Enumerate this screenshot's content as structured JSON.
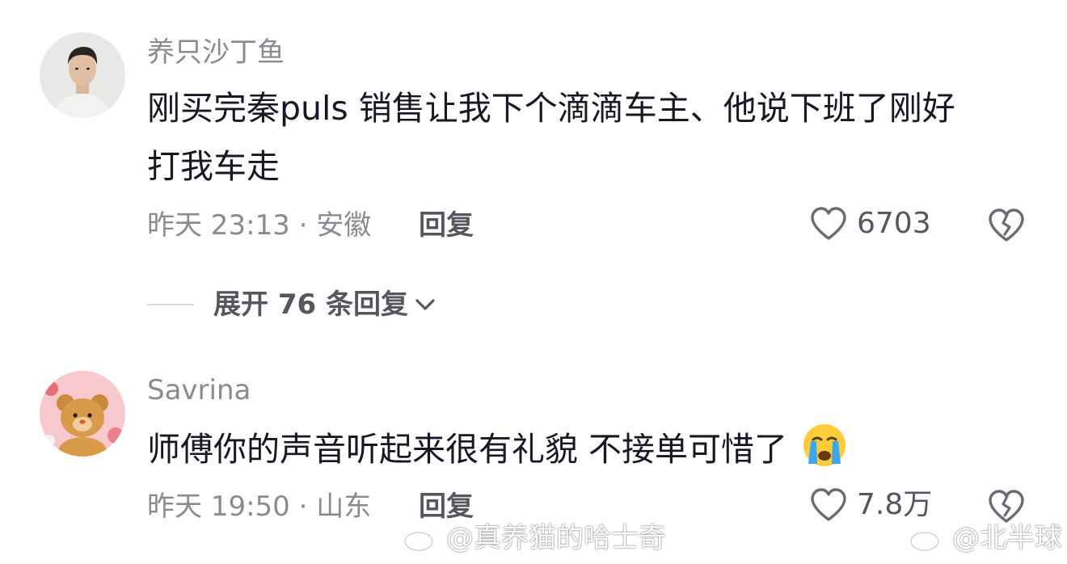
{
  "comments": [
    {
      "username": "养只沙丁鱼",
      "text_line1": "刚买完秦puls 销售让我下个滴滴车主、他说下班了刚好",
      "text_line2": "打我车走",
      "meta": "昨天 23:13 · 安徽",
      "reply_label": "回复",
      "like_count": "6703"
    },
    {
      "username": "Savrina",
      "text": "师傅你的声音听起来很有礼貌 不接单可惜了",
      "emoji": "crying-face",
      "meta": "昨天 19:50 · 山东",
      "reply_label": "回复",
      "like_count": "7.8万"
    }
  ],
  "expand_replies": {
    "label": "展开 76 条回复"
  },
  "watermarks": [
    {
      "text": "@真养猫的哈士奇"
    },
    {
      "text": "@北半球"
    }
  ],
  "icons": {
    "like": "heart-outline-icon",
    "dislike": "broken-heart-icon",
    "expand": "chevron-down-icon",
    "watermark": "weibo-logo-icon"
  },
  "colors": {
    "text_primary": "#161823",
    "text_secondary": "#8a8b91",
    "action": "#555660"
  }
}
